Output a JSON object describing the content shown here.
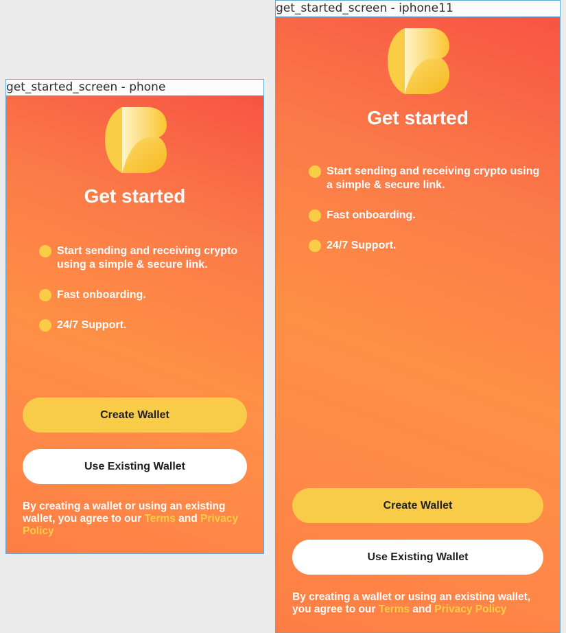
{
  "frames": [
    {
      "label": "get_started_screen - phone",
      "title": "Get started",
      "features": [
        "Start sending and receiving crypto using a simple & secure link.",
        "Fast onboarding.",
        "24/7 Support."
      ],
      "create_wallet": "Create Wallet",
      "use_existing_wallet": "Use Existing Wallet",
      "terms": {
        "prefix": "By creating a wallet or using an existing wallet, you agree to our ",
        "terms_link": "Terms",
        "middle": " and ",
        "privacy_link": "Privacy Policy"
      }
    },
    {
      "label": "get_started_screen - iphone11",
      "title": "Get started",
      "features": [
        "Start sending and receiving crypto using a simple & secure link.",
        "Fast onboarding.",
        "24/7 Support."
      ],
      "create_wallet": "Create Wallet",
      "use_existing_wallet": "Use Existing Wallet",
      "terms": {
        "prefix": "By creating a wallet or using an existing wallet, you agree to our ",
        "terms_link": "Terms",
        "middle": " and ",
        "privacy_link": "Privacy Policy"
      }
    }
  ],
  "colors": {
    "accent_yellow": "#f8cc48",
    "gradient_start": "#f75443",
    "gradient_end": "#ff8f45",
    "text_white": "#ffffff",
    "frame_border": "#5aa9d6"
  },
  "icons": {
    "logo": "app-logo-icon",
    "bullet": "bullet-dot-icon"
  }
}
